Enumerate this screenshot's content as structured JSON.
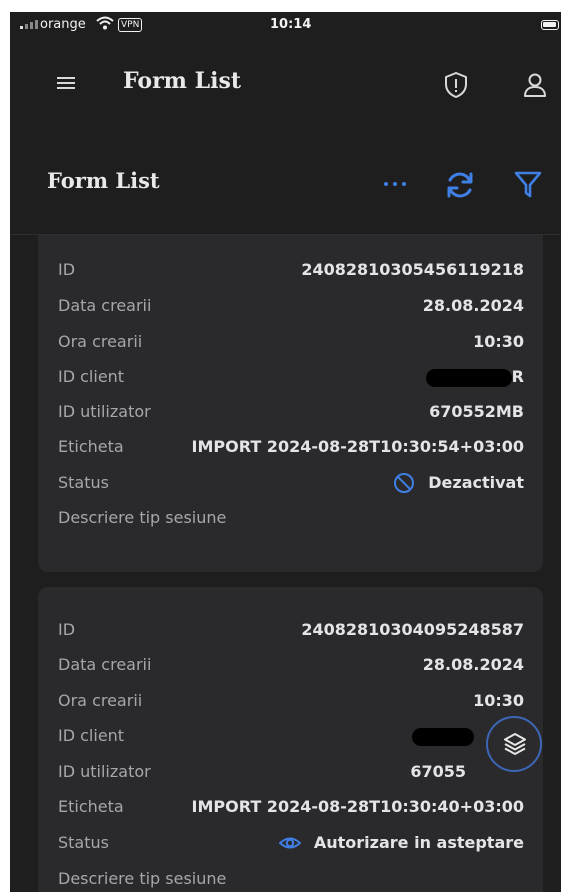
{
  "status_bar": {
    "carrier": "orange",
    "vpn": "VPN",
    "time": "10:14"
  },
  "app_bar": {
    "title": "Form List",
    "icons": [
      "menu-icon",
      "shield-alert-icon",
      "user-icon"
    ]
  },
  "page_header": {
    "title": "Form List",
    "icons": [
      "more-icon",
      "refresh-icon",
      "filter-icon"
    ],
    "accent_color": "#3f7fe6"
  },
  "cards": [
    {
      "rows": [
        {
          "label": "ID",
          "value": "24082810305456119218"
        },
        {
          "label": "Data crearii",
          "value": "28.08.2024"
        },
        {
          "label": "Ora crearii",
          "value": "10:30"
        },
        {
          "label": "ID client",
          "value": "R"
        },
        {
          "label": "ID utilizator",
          "value": "670552MB"
        },
        {
          "label": "Eticheta",
          "value": "IMPORT 2024-08-28T10:30:54+03:00"
        },
        {
          "label": "Status",
          "value": "Dezactivat",
          "icon": "disabled-icon"
        },
        {
          "label": "Descriere tip sesiune",
          "value": ""
        }
      ]
    },
    {
      "rows": [
        {
          "label": "ID",
          "value": "24082810304095248587"
        },
        {
          "label": "Data crearii",
          "value": "28.08.2024"
        },
        {
          "label": "Ora crearii",
          "value": "10:30"
        },
        {
          "label": "ID client",
          "value": ""
        },
        {
          "label": "ID utilizator",
          "value": "67055"
        },
        {
          "label": "Eticheta",
          "value": "IMPORT 2024-08-28T10:30:40+03:00"
        },
        {
          "label": "Status",
          "value": "Autorizare in asteptare",
          "icon": "eye-icon"
        },
        {
          "label": "Descriere tip sesiune",
          "value": ""
        }
      ]
    }
  ],
  "fab": {
    "icon": "layers-icon"
  }
}
